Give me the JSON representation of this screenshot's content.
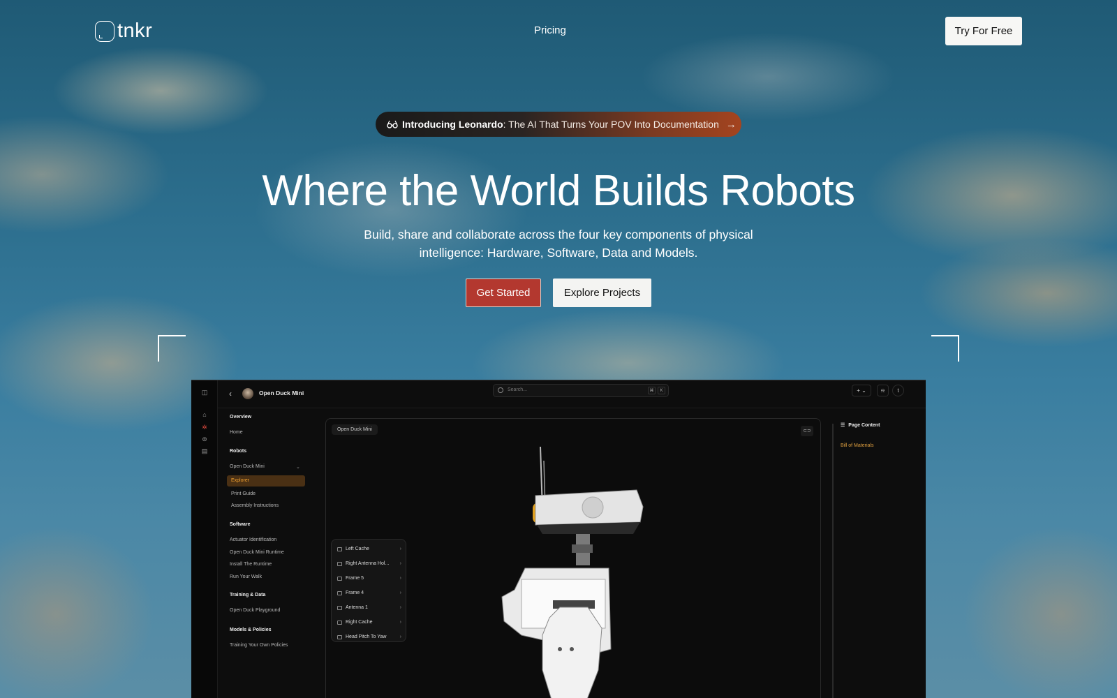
{
  "nav": {
    "logo_text": "tnkr",
    "pricing_label": "Pricing",
    "cta_label": "Try For Free"
  },
  "announcement": {
    "bold_text": "Introducing Leonardo",
    "rest_text": ": The AI That Turns Your POV Into Documentation",
    "icon": "glasses-icon",
    "arrow_icon": "arrow-right-icon"
  },
  "hero": {
    "title": "Where the World Builds Robots",
    "subtitle": "Build, share and collaborate across the four key components of physical intelligence: Hardware, Software, Data and Models.",
    "primary_label": "Get Started",
    "secondary_label": "Explore Projects",
    "primary_color": "#b3382f"
  },
  "app": {
    "project_name": "Open Duck Mini",
    "search_placeholder": "Search...",
    "kbd_cmd": "⌘",
    "kbd_k": "K",
    "add_label": "+ ⌄",
    "user_initial": "t",
    "sidebar": {
      "overview": "Overview",
      "home": "Home",
      "robots": "Robots",
      "robot_name": "Open Duck Mini",
      "explorer": "Explorer",
      "print_guide": "Print Guide",
      "assembly": "Assembly Instructions",
      "software": "Software",
      "software_items": [
        "Actuator Identification",
        "Open Duck Mini Runtime",
        "Install The Runtime",
        "Run Your Walk"
      ],
      "training": "Training & Data",
      "training_item": "Open Duck Playground",
      "models": "Models & Policies",
      "models_item": "Training Your Own Policies"
    },
    "viewer": {
      "tag": "Open Duck Mini",
      "parts": [
        "Left Cache",
        "Right Antenna Hol...",
        "Frame 5",
        "Frame 4",
        "Antenna 1",
        "Right Cache",
        "Head Pitch To Yaw"
      ]
    },
    "toc": {
      "title": "Page Content",
      "item": "Bill of Materials"
    },
    "accent": "#f0a030"
  }
}
